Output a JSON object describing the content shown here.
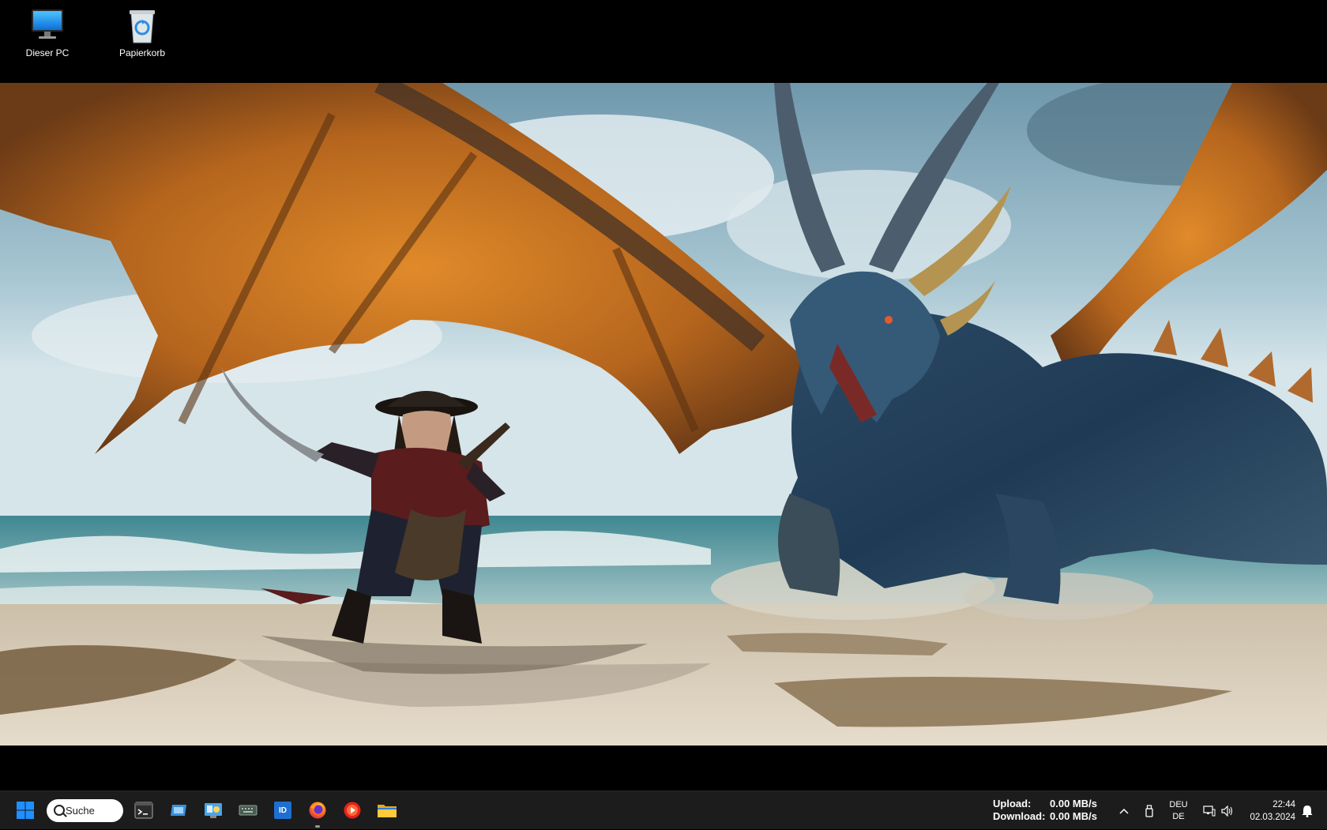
{
  "desktop": {
    "icons": [
      {
        "label": "Dieser PC",
        "icon": "computer-icon"
      },
      {
        "label": "Papierkorb",
        "icon": "recycle-bin-icon"
      }
    ]
  },
  "taskbar": {
    "search": {
      "label": "Suche"
    },
    "apps": [
      {
        "name": "terminal",
        "icon": "terminal-icon"
      },
      {
        "name": "screen-capture",
        "icon": "window-capture-icon"
      },
      {
        "name": "control-panel",
        "icon": "control-panel-icon"
      },
      {
        "name": "keyboard",
        "icon": "keyboard-icon"
      },
      {
        "name": "id-app",
        "icon": "id-icon",
        "icon_text": "ID"
      },
      {
        "name": "firefox",
        "icon": "firefox-icon"
      },
      {
        "name": "media-player",
        "icon": "media-player-icon"
      },
      {
        "name": "file-explorer",
        "icon": "folder-icon"
      }
    ],
    "network": {
      "upload_label": "Upload:",
      "upload_value": "0.00 MB/s",
      "download_label": "Download:",
      "download_value": "0.00 MB/s"
    },
    "tray": {
      "language_line1": "DEU",
      "language_line2": "DE"
    },
    "clock": {
      "time": "22:44",
      "date": "02.03.2024"
    }
  },
  "colors": {
    "taskbar_bg": "#1c1c1c",
    "windows_blue": "#1e90ff"
  }
}
